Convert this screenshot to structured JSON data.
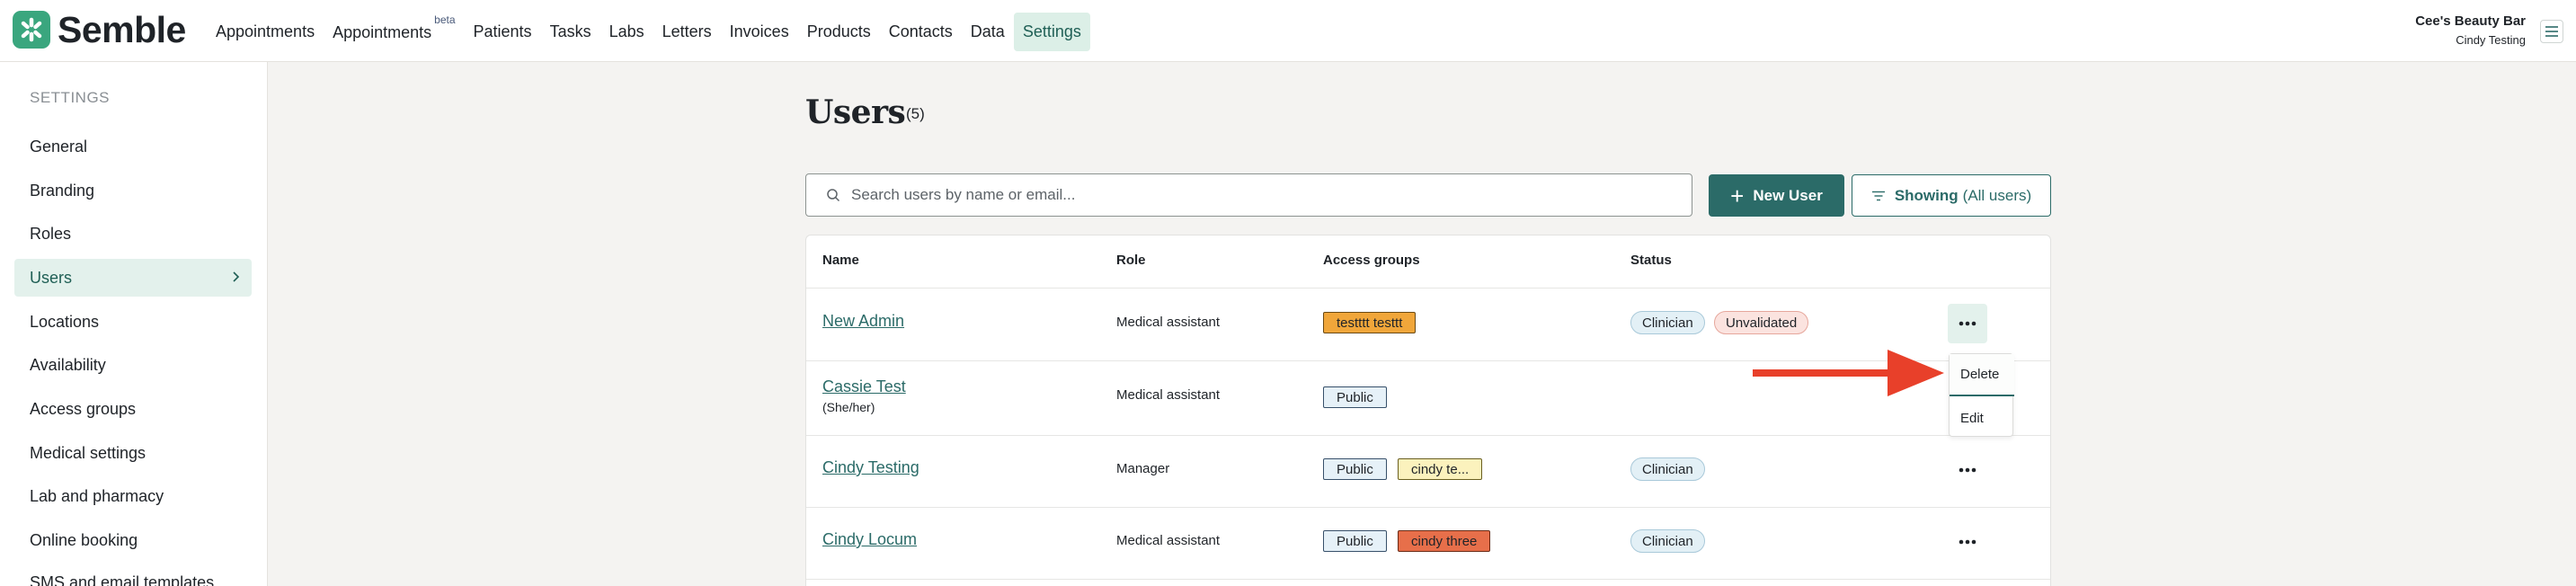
{
  "brand": {
    "name": "Semble",
    "color": "#3aa67e"
  },
  "nav": {
    "items": [
      {
        "label": "Appointments",
        "badge": ""
      },
      {
        "label": "Appointments",
        "badge": "beta"
      },
      {
        "label": "Patients",
        "badge": ""
      },
      {
        "label": "Tasks",
        "badge": ""
      },
      {
        "label": "Labs",
        "badge": ""
      },
      {
        "label": "Letters",
        "badge": ""
      },
      {
        "label": "Invoices",
        "badge": ""
      },
      {
        "label": "Products",
        "badge": ""
      },
      {
        "label": "Contacts",
        "badge": ""
      },
      {
        "label": "Data",
        "badge": ""
      },
      {
        "label": "Settings",
        "badge": ""
      }
    ],
    "active": "Settings"
  },
  "account": {
    "org": "Cee's Beauty Bar",
    "user": "Cindy Testing"
  },
  "sidebar": {
    "heading": "SETTINGS",
    "items": [
      {
        "label": "General"
      },
      {
        "label": "Branding"
      },
      {
        "label": "Roles"
      },
      {
        "label": "Users"
      },
      {
        "label": "Locations"
      },
      {
        "label": "Availability"
      },
      {
        "label": "Access groups"
      },
      {
        "label": "Medical settings"
      },
      {
        "label": "Lab and pharmacy"
      },
      {
        "label": "Online booking"
      },
      {
        "label": "SMS and email templates"
      }
    ],
    "active": "Users"
  },
  "main": {
    "title": "Users",
    "count": "(5)",
    "search_placeholder": "Search users by name or email...",
    "new_user_label": "New User",
    "filter_label": "Showing",
    "filter_value": "(All users)"
  },
  "table": {
    "headers": {
      "name": "Name",
      "role": "Role",
      "access": "Access groups",
      "status": "Status"
    },
    "rows": [
      {
        "name": "New Admin",
        "pronouns": "",
        "role": "Medical assistant",
        "groups": [
          "testttt testtt"
        ],
        "statuses": [
          "Clinician",
          "Unvalidated"
        ]
      },
      {
        "name": "Cassie Test",
        "pronouns": "(She/her)",
        "role": "Medical assistant",
        "groups": [
          "Public"
        ],
        "statuses": []
      },
      {
        "name": "Cindy Testing",
        "pronouns": "",
        "role": "Manager",
        "groups": [
          "Public",
          "cindy te..."
        ],
        "statuses": [
          "Clinician"
        ]
      },
      {
        "name": "Cindy Locum",
        "pronouns": "",
        "role": "Medical assistant",
        "groups": [
          "Public",
          "cindy three"
        ],
        "statuses": [
          "Clinician"
        ]
      }
    ]
  },
  "row_menu": {
    "items": [
      "Delete",
      "Edit"
    ]
  },
  "colors": {
    "accent": "#2b6b68",
    "arrow": "#e8402a",
    "active_bg": "#e3f1ec"
  }
}
